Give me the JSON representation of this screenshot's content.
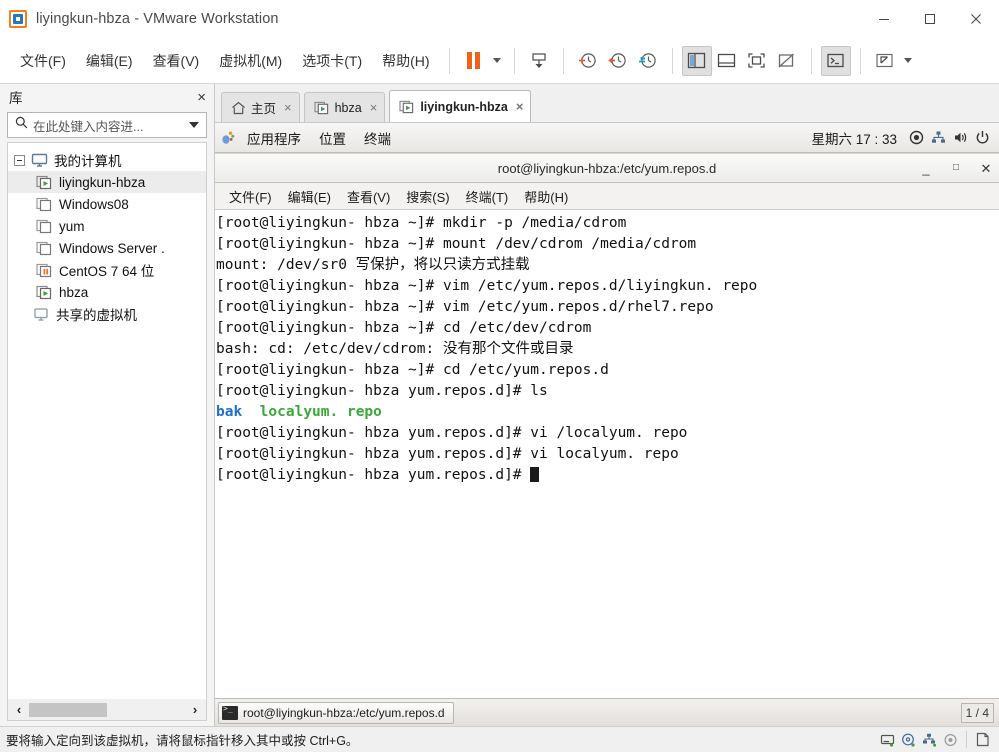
{
  "window": {
    "title": "liyingkun-hbza - VMware Workstation",
    "app_icon": "vmware-logo-icon",
    "minimize_label": "最小化",
    "maximize_label": "最大化",
    "close_label": "关闭"
  },
  "menubar": {
    "items": [
      {
        "label": "文件(F)",
        "name": "menu-file"
      },
      {
        "label": "编辑(E)",
        "name": "menu-edit"
      },
      {
        "label": "查看(V)",
        "name": "menu-view"
      },
      {
        "label": "虚拟机(M)",
        "name": "menu-vm"
      },
      {
        "label": "选项卡(T)",
        "name": "menu-tabs"
      },
      {
        "label": "帮助(H)",
        "name": "menu-help"
      }
    ]
  },
  "toolbar": {
    "buttons": [
      {
        "name": "suspend-button",
        "icon": "pause-icon"
      },
      {
        "name": "power-dropdown",
        "icon": "chevron-down-icon"
      },
      {
        "name": "send-ctrl-alt-del-button",
        "icon": "keyboard-send-icon"
      },
      {
        "name": "snapshot-take-button",
        "icon": "clock-plus-icon"
      },
      {
        "name": "snapshot-revert-button",
        "icon": "clock-back-icon"
      },
      {
        "name": "snapshot-manager-button",
        "icon": "clock-manage-icon"
      },
      {
        "name": "show-library-button",
        "icon": "panel-left-icon"
      },
      {
        "name": "show-thumbnail-bar-button",
        "icon": "panel-bottom-icon"
      },
      {
        "name": "show-console-view-button",
        "icon": "fullscreen-box-icon"
      },
      {
        "name": "hide-console-view-button",
        "icon": "box-crossed-icon"
      },
      {
        "name": "console-terminal-button",
        "icon": "terminal-icon"
      },
      {
        "name": "enter-fullscreen-button",
        "icon": "expand-arrows-icon"
      },
      {
        "name": "fullscreen-dropdown",
        "icon": "chevron-down-icon"
      }
    ]
  },
  "sidebar": {
    "title": "库",
    "close_label": "×",
    "search_placeholder": "在此处键入内容进...",
    "tree": [
      {
        "label": "我的计算机",
        "level": 1,
        "icon": "computer-icon",
        "name": "tree-item-my-computer",
        "expander": true,
        "selected": false
      },
      {
        "label": "liyingkun-hbza",
        "level": 2,
        "icon": "vm-running-icon",
        "name": "tree-item-liyingkun-hbza",
        "selected": true
      },
      {
        "label": "Windows08",
        "level": 2,
        "icon": "vm-off-icon",
        "name": "tree-item-windows08",
        "selected": false
      },
      {
        "label": "yum",
        "level": 2,
        "icon": "vm-off-icon",
        "name": "tree-item-yum",
        "selected": false
      },
      {
        "label": "Windows Server .",
        "level": 2,
        "icon": "vm-off-icon",
        "name": "tree-item-windows-server",
        "selected": false
      },
      {
        "label": "CentOS 7 64 位",
        "level": 2,
        "icon": "vm-suspended-icon",
        "name": "tree-item-centos7",
        "selected": false
      },
      {
        "label": "hbza",
        "level": 2,
        "icon": "vm-running-icon",
        "name": "tree-item-hbza",
        "selected": false
      },
      {
        "label": "共享的虚拟机",
        "level": 1,
        "icon": "shared-vm-icon",
        "name": "tree-item-shared-vms",
        "expander": false,
        "selected": false
      }
    ],
    "scroll_left": "‹",
    "scroll_right": "›"
  },
  "tabs": [
    {
      "label": "主页",
      "icon": "home-icon",
      "active": false,
      "name": "tab-home",
      "close": "×"
    },
    {
      "label": "hbza",
      "icon": "vm-running-icon",
      "active": false,
      "name": "tab-hbza",
      "close": "×"
    },
    {
      "label": "liyingkun-hbza",
      "icon": "vm-running-icon",
      "active": true,
      "name": "tab-liyingkun-hbza",
      "close": "×"
    }
  ],
  "guest": {
    "panel": {
      "menus": [
        {
          "label": "应用程序",
          "name": "gnome-applications-menu"
        },
        {
          "label": "位置",
          "name": "gnome-places-menu"
        },
        {
          "label": "终端",
          "name": "gnome-terminal-menu"
        }
      ],
      "clock": "星期六 17 : 33",
      "tray": [
        {
          "name": "record-indicator-icon"
        },
        {
          "name": "network-icon"
        },
        {
          "name": "volume-icon"
        },
        {
          "name": "power-icon"
        }
      ]
    },
    "terminal": {
      "title": "root@liyingkun-hbza:/etc/yum.repos.d",
      "window_buttons": {
        "minimize": "_",
        "maximize": "□",
        "close": "✕"
      },
      "menus": [
        {
          "label": "文件(F)",
          "name": "term-menu-file"
        },
        {
          "label": "编辑(E)",
          "name": "term-menu-edit"
        },
        {
          "label": "查看(V)",
          "name": "term-menu-view"
        },
        {
          "label": "搜索(S)",
          "name": "term-menu-search"
        },
        {
          "label": "终端(T)",
          "name": "term-menu-terminal"
        },
        {
          "label": "帮助(H)",
          "name": "term-menu-help"
        }
      ],
      "lines": [
        {
          "text": "[root@liyingkun- hbza ~]# mkdir -p /media/cdrom"
        },
        {
          "text": "[root@liyingkun- hbza ~]# mount /dev/cdrom /media/cdrom"
        },
        {
          "text": "mount: /dev/sr0 写保护，将以只读方式挂载"
        },
        {
          "text": "[root@liyingkun- hbza ~]# vim /etc/yum.repos.d/liyingkun. repo"
        },
        {
          "text": "[root@liyingkun- hbza ~]# vim /etc/yum.repos.d/rhel7.repo"
        },
        {
          "text": "[root@liyingkun- hbza ~]# cd /etc/dev/cdrom"
        },
        {
          "text": "bash: cd: /etc/dev/cdrom: 没有那个文件或目录"
        },
        {
          "text": "[root@liyingkun- hbza ~]# cd /etc/yum.repos.d"
        },
        {
          "text": "[root@liyingkun- hbza yum.repos.d]# ls"
        },
        {
          "segments": [
            {
              "text": "bak",
              "color": "blue"
            },
            {
              "text": "  "
            },
            {
              "text": "localyum. repo",
              "color": "green"
            }
          ]
        },
        {
          "text": "[root@liyingkun- hbza yum.repos.d]# vi /localyum. repo"
        },
        {
          "text": "[root@liyingkun- hbza yum.repos.d]# vi localyum. repo"
        },
        {
          "text": "[root@liyingkun- hbza yum.repos.d]# ",
          "cursor": true
        }
      ],
      "colors": {
        "blue": "#1f6fd0",
        "green": "#3ba83b",
        "foreground": "#111111",
        "background": "#ffffff"
      }
    },
    "taskbar": {
      "task_label": "root@liyingkun-hbza:/etc/yum.repos.d",
      "task_icon": "terminal-icon",
      "workspace": "1 / 4"
    }
  },
  "statusbar": {
    "message": "要将输入定向到该虚拟机，请将鼠标指针移入其中或按 Ctrl+G。",
    "icons": [
      {
        "name": "hard-disk-icon"
      },
      {
        "name": "cd-dvd-icon"
      },
      {
        "name": "network-adapter-icon"
      },
      {
        "name": "usb-icon"
      },
      {
        "name": "printer-icon"
      }
    ]
  }
}
